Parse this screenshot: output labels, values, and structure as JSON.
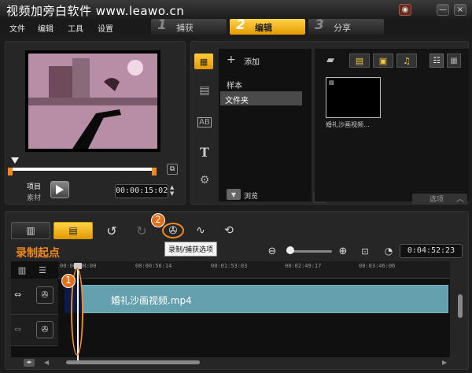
{
  "window": {
    "title": "视频加旁白软件 www.leawo.cn",
    "min": "—",
    "close": "×",
    "menu_glyph": "◉"
  },
  "menu": [
    "文件",
    "编辑",
    "工具",
    "设置"
  ],
  "steps": [
    {
      "num": "1",
      "label": "捕获"
    },
    {
      "num": "2",
      "label": "编辑"
    },
    {
      "num": "3",
      "label": "分享"
    }
  ],
  "player": {
    "project_label": "项目",
    "clip_label": "素材",
    "timecode": "00:00:15:02"
  },
  "library": {
    "add_label": "添加",
    "items": [
      "样本",
      "文件夹"
    ],
    "browse_label": "浏览",
    "options_label": "选项",
    "thumb_caption": "婚礼沙画视频..."
  },
  "timeline": {
    "record_start_label": "录制起点",
    "tooltip": "录制/捕获选项",
    "duration": "0:04:52:23",
    "ticks": [
      "00:00:00:00",
      "00:00:56:14",
      "00:01:53:03",
      "00:02:49:17",
      "00:03:46:06"
    ],
    "clip_name": "婚礼沙画视频.mp4",
    "annotation_1": "1",
    "annotation_2": "2"
  }
}
